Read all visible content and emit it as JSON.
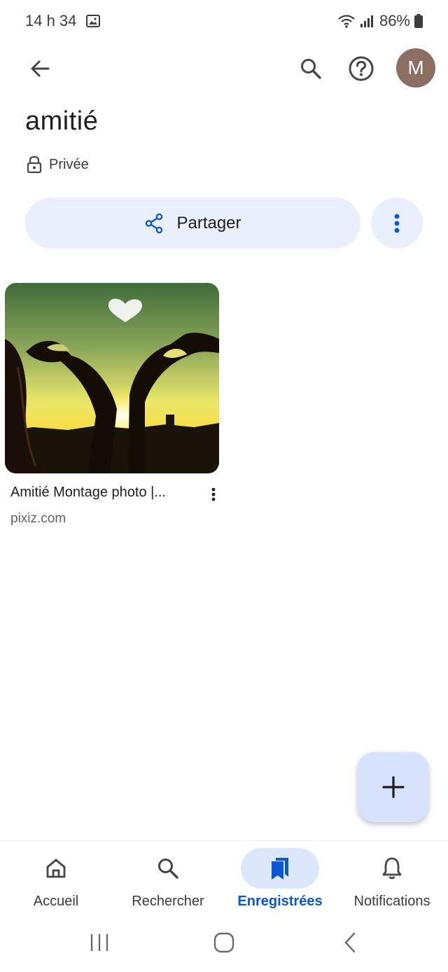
{
  "status_bar": {
    "time": "14 h 34",
    "battery": "86%"
  },
  "header": {
    "avatar_letter": "M",
    "icons": [
      "back-arrow-icon",
      "search-icon",
      "help-icon"
    ]
  },
  "collection": {
    "title": "amitié",
    "privacy": "Privée",
    "share_label": "Partager"
  },
  "items": [
    {
      "title": "Amitié Montage photo |...",
      "source": "pixiz.com"
    }
  ],
  "bottom_nav": {
    "items": [
      {
        "label": "Accueil",
        "icon": "home-icon"
      },
      {
        "label": "Rechercher",
        "icon": "search-icon"
      },
      {
        "label": "Enregistrées",
        "icon": "bookmarks-icon",
        "active": true
      },
      {
        "label": "Notifications",
        "icon": "bell-icon"
      }
    ]
  },
  "colors": {
    "accent": "#0b57d0",
    "button_bg": "#e8f0fc",
    "fab_bg": "#d7e3fc",
    "avatar_bg": "#8d6e63"
  }
}
